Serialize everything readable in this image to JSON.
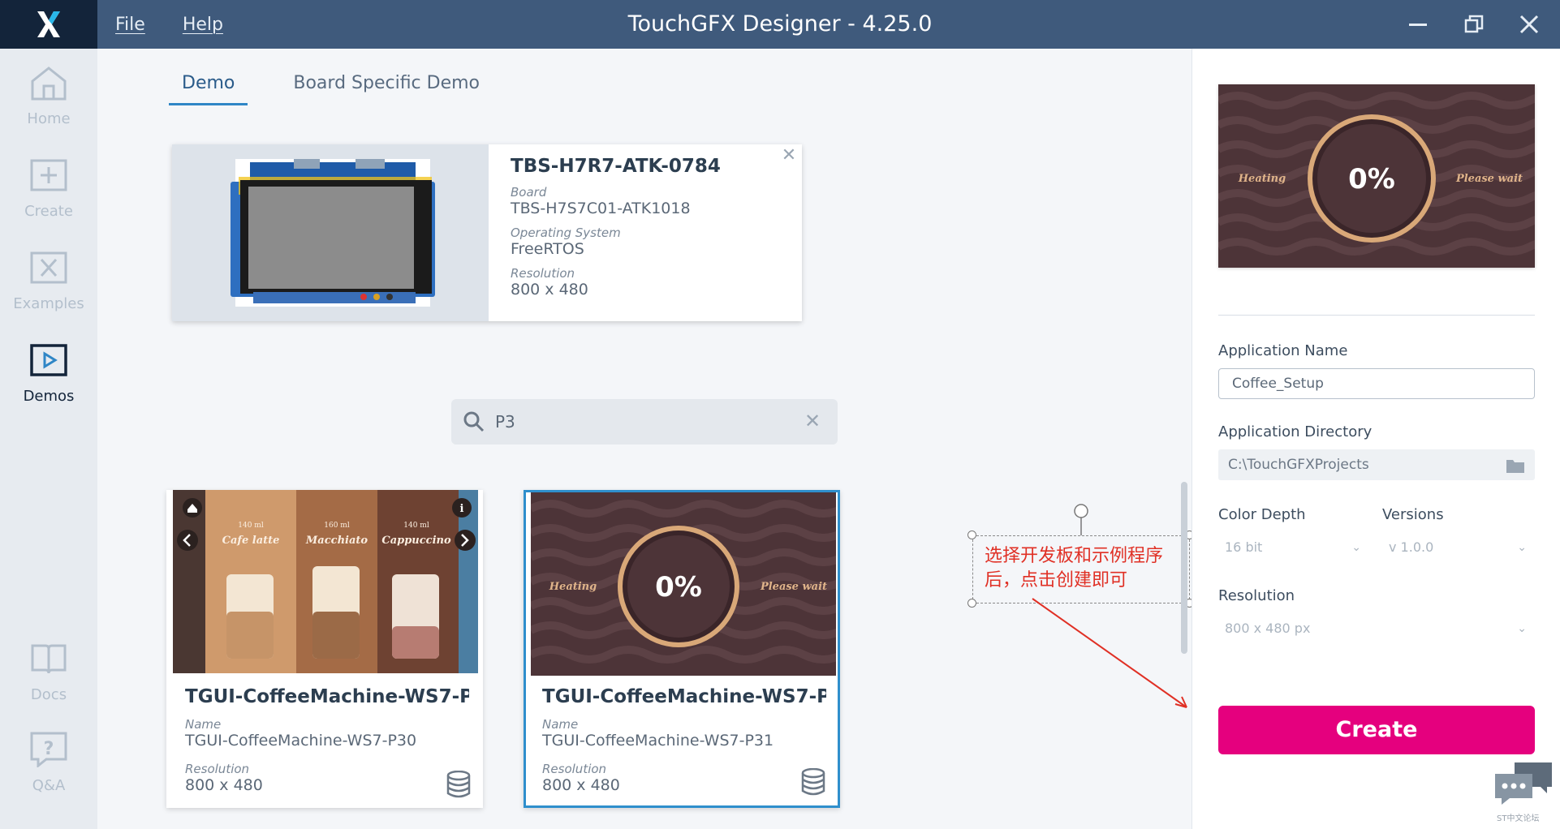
{
  "window": {
    "title": "TouchGFX Designer - 4.25.0",
    "menu": [
      "File",
      "Help"
    ]
  },
  "sidebar": {
    "items": [
      {
        "label": "Home",
        "icon": "home-icon"
      },
      {
        "label": "Create",
        "icon": "create-icon"
      },
      {
        "label": "Examples",
        "icon": "examples-icon"
      },
      {
        "label": "Demos",
        "icon": "demos-icon",
        "active": true
      },
      {
        "label": "Docs",
        "icon": "book-icon"
      },
      {
        "label": "Q&A",
        "icon": "question-icon"
      }
    ]
  },
  "tabs": [
    {
      "label": "Demo",
      "active": true
    },
    {
      "label": "Board Specific Demo",
      "active": false
    }
  ],
  "board": {
    "name": "TBS-H7R7-ATK-0784",
    "board_label": "Board",
    "board_value": "TBS-H7S7C01-ATK1018",
    "os_label": "Operating System",
    "os_value": "FreeRTOS",
    "res_label": "Resolution",
    "res_value": "800 x 480"
  },
  "search": {
    "value": "P3"
  },
  "demo_cards": [
    {
      "title": "TGUI-CoffeeMachine-WS7-P...",
      "name_label": "Name",
      "name_value": "TGUI-CoffeeMachine-WS7-P30",
      "res_label": "Resolution",
      "res_value": "800 x 480",
      "thumb": {
        "drinks": [
          {
            "size": "140 ml",
            "name": "Cafe latte"
          },
          {
            "size": "160 ml",
            "name": "Macchiato"
          },
          {
            "size": "140 ml",
            "name": "Cappuccino"
          }
        ]
      }
    },
    {
      "title": "TGUI-CoffeeMachine-WS7-P...",
      "name_label": "Name",
      "name_value": "TGUI-CoffeeMachine-WS7-P31",
      "res_label": "Resolution",
      "res_value": "800 x 480",
      "selected": true,
      "thumb": {
        "left": "Heating",
        "center": "0%",
        "right": "Please wait"
      }
    }
  ],
  "annotation": {
    "line1": "选择开发板和示例程序",
    "line2": "后，点击创建即可"
  },
  "right_panel": {
    "preview": {
      "left": "Heating",
      "center": "0%",
      "right": "Please wait"
    },
    "app_name_label": "Application Name",
    "app_name_value": "Coffee_Setup",
    "app_dir_label": "Application Directory",
    "app_dir_value": "C:\\TouchGFXProjects",
    "color_depth_label": "Color Depth",
    "color_depth_value": "16 bit",
    "versions_label": "Versions",
    "versions_value": "v 1.0.0",
    "resolution_label": "Resolution",
    "resolution_value": "800 x 480 px",
    "create_label": "Create"
  },
  "watermark": "ST中文论坛",
  "colors": {
    "titlebar": "#3f5a7c",
    "accent": "#2f86c6",
    "create": "#e5007e",
    "annotation": "#e03025"
  }
}
